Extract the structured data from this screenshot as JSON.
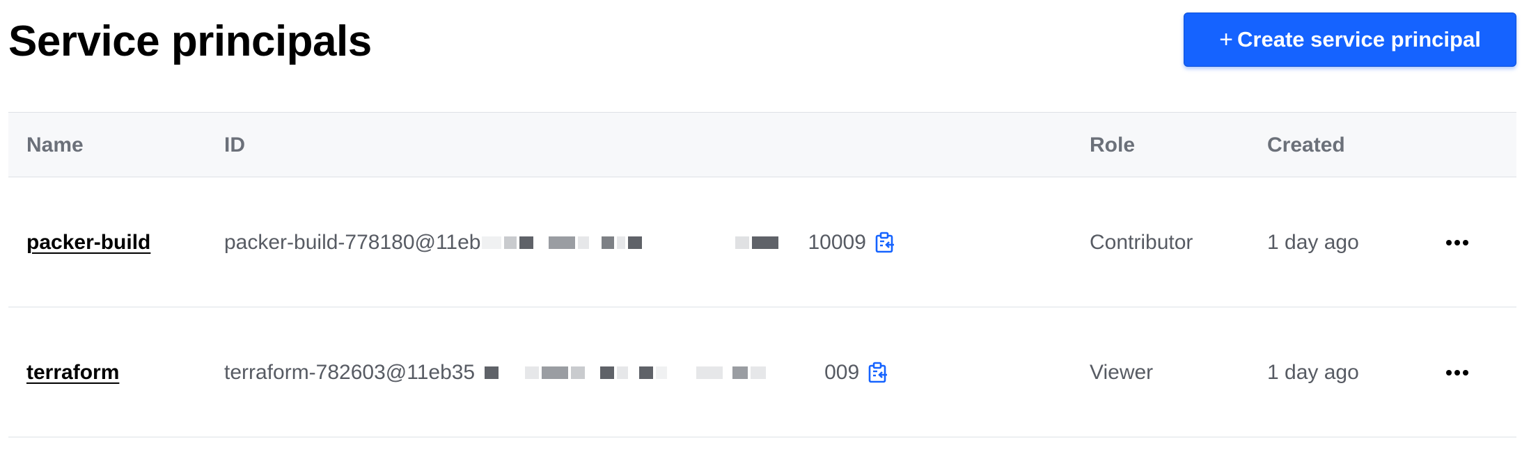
{
  "page": {
    "title": "Service principals",
    "create_button": {
      "plus": "+",
      "label": "Create service principal"
    }
  },
  "table": {
    "columns": {
      "name": "Name",
      "id": "ID",
      "role": "Role",
      "created": "Created"
    },
    "rows": [
      {
        "name": "packer-build",
        "id_prefix": "packer-build-778180@11eb",
        "id_suffix": "10009",
        "role": "Contributor",
        "created": "1 day ago"
      },
      {
        "name": "terraform",
        "id_prefix": "terraform-782603@11eb35",
        "id_suffix": "009",
        "role": "Viewer",
        "created": "1 day ago"
      }
    ]
  },
  "colors": {
    "accent": "#1563ff",
    "redaction_dark": "#5f6268",
    "redaction_mid": "#9a9da2",
    "redaction_light": "#e6e7e9"
  },
  "icons": {
    "copy": "clipboard-copy-icon",
    "more": "more-horizontal-icon"
  }
}
